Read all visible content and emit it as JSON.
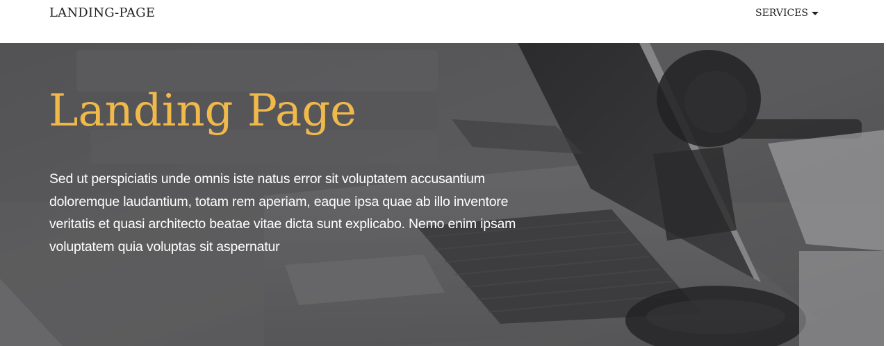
{
  "navbar": {
    "brand": "LANDING-PAGE",
    "services_label": "SERVICES",
    "services_icon": "caret-down-icon"
  },
  "hero": {
    "title": "Landing Page",
    "text": "Sed ut perspiciatis unde omnis iste natus error sit voluptatem accusantium doloremque laudantium, totam rem aperiam, eaque ipsa quae ab illo inventore veritatis et quasi architecto beatae vitae dicta sunt explicabo. Nemo enim ipsam voluptatem quia voluptas sit aspernatur",
    "background_image": "laptop-desk-photo"
  },
  "colors": {
    "title_accent": "#f0b94a",
    "navbar_bg": "#ffffff",
    "nav_text": "#222222",
    "hero_text": "#ffffff"
  }
}
